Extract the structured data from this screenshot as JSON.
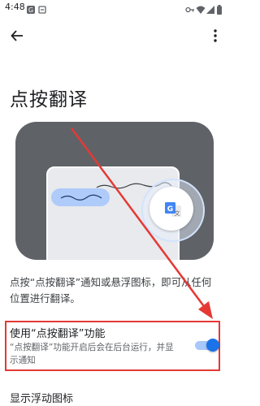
{
  "status_bar": {
    "time": "4:48",
    "icons": [
      "notification-icon",
      "key-icon",
      "wifi-icon",
      "signal-icon",
      "battery-icon"
    ]
  },
  "header": {
    "back_icon": "arrow-back-icon",
    "more_icon": "more-vert-icon"
  },
  "page": {
    "title": "点按翻译",
    "illustration": {
      "bubble_icon": "google-translate-icon",
      "colors": {
        "background": "#5f6368",
        "paper": "#e8eaed",
        "highlight_pill": "#aecbfa",
        "bubble_ring": "#d2e3fc"
      }
    },
    "description": "点按“点按翻译”通知或悬浮图标，即可从任何位置进行翻译。"
  },
  "settings": [
    {
      "title": "使用“点按翻译”功能",
      "subtitle": "“点按翻译”功能开启后会在后台运行，并显示通知",
      "enabled": true
    }
  ],
  "next_setting": {
    "title": "显示浮动图标"
  },
  "colors": {
    "accent": "#1a73e8",
    "toggle_track": "#a8c7fa",
    "annotation": "#e53935"
  }
}
